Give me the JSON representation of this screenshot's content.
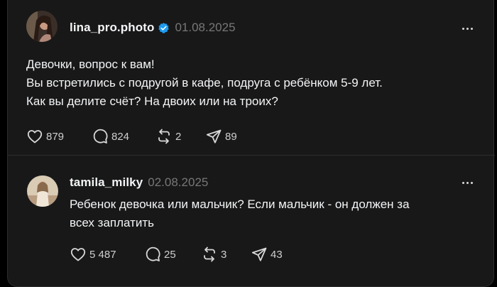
{
  "posts": [
    {
      "username": "lina_pro.photo",
      "verified": true,
      "date": "01.08.2025",
      "text_lines": [
        "Девочки, вопрос к вам!",
        "Вы встретились с подругой в кафе, подруга с ребёнком 5-9 лет.",
        "Как вы делите счёт? На двоих или на троих?"
      ],
      "likes": "879",
      "replies": "824",
      "reposts": "2",
      "shares": "89"
    },
    {
      "username": "tamila_milky",
      "verified": false,
      "date": "02.08.2025",
      "text_lines": [
        "Ребенок девочка или мальчик? Если мальчик - он должен за",
        "всех заплатить"
      ],
      "likes": "5 487",
      "replies": "25",
      "reposts": "3",
      "shares": "43"
    }
  ],
  "icons": {
    "like": "heart-icon",
    "reply": "comment-icon",
    "repost": "repost-icon",
    "share": "send-icon",
    "more": "more-icon",
    "verified": "verified-badge-icon"
  },
  "colors": {
    "background": "#181818",
    "text": "#f3f5f7",
    "muted": "#777777",
    "verified": "#1d9bf0"
  }
}
